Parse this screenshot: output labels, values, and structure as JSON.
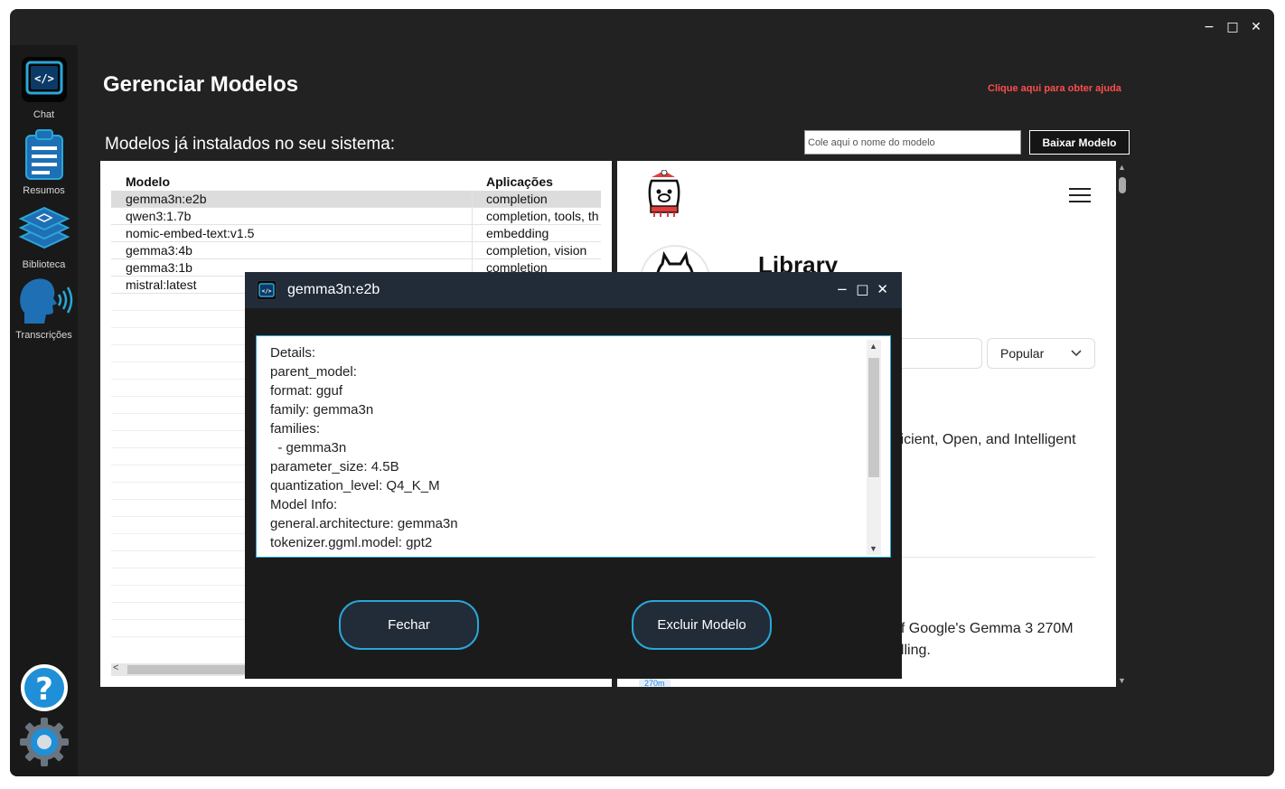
{
  "window": {
    "controls": {
      "minimize": "−",
      "maximize": "□",
      "close": "✕"
    }
  },
  "sidebar": {
    "items": [
      {
        "label": "Chat",
        "icon": "code-chat-icon"
      },
      {
        "label": "Resumos",
        "icon": "clipboard-icon"
      },
      {
        "label": "Biblioteca",
        "icon": "book-stack-icon"
      },
      {
        "label": "Transcrições",
        "icon": "speaking-head-icon"
      }
    ],
    "bottom": [
      {
        "icon": "help-icon",
        "glyph": "?"
      },
      {
        "icon": "gear-icon"
      }
    ]
  },
  "header": {
    "title": "Gerenciar Modelos",
    "help_link": "Clique aqui para obter ajuda"
  },
  "installed": {
    "label": "Modelos já instalados no seu sistema:",
    "input_placeholder": "Cole aqui o nome do modelo",
    "download_button": "Baixar Modelo"
  },
  "table": {
    "columns": [
      "Modelo",
      "Aplicações"
    ],
    "rows": [
      {
        "model": "gemma3n:e2b",
        "apps": "completion"
      },
      {
        "model": "qwen3:1.7b",
        "apps": "completion, tools, th"
      },
      {
        "model": "nomic-embed-text:v1.5",
        "apps": "embedding"
      },
      {
        "model": "gemma3:4b",
        "apps": "completion, vision"
      },
      {
        "model": "gemma3:1b",
        "apps": "completion"
      },
      {
        "model": "mistral:latest",
        "apps": ""
      }
    ],
    "scroll_arrow": "<"
  },
  "web": {
    "library_title": "Library",
    "sort_select": "Popular",
    "desc1": "fficient, Open, and Intelligent",
    "desc2_line1": "of Google's Gemma 3 270M",
    "desc2_line2": "alling.",
    "tag": "270m"
  },
  "dialog": {
    "title": "gemma3n:e2b",
    "details": "Details:\nparent_model:\nformat: gguf\nfamily: gemma3n\nfamilies:\n  - gemma3n\nparameter_size: 4.5B\nquantization_level: Q4_K_M\nModel Info:\ngeneral.architecture: gemma3n\ntokenizer.ggml.model: gpt2",
    "close_button": "Fechar",
    "delete_button": "Excluir Modelo",
    "controls": {
      "minimize": "−",
      "maximize": "□",
      "close": "✕"
    }
  },
  "colors": {
    "accent": "#2aa7d8",
    "help_link": "#ff4d4d",
    "background": "#222222",
    "sidebar": "#191919"
  }
}
